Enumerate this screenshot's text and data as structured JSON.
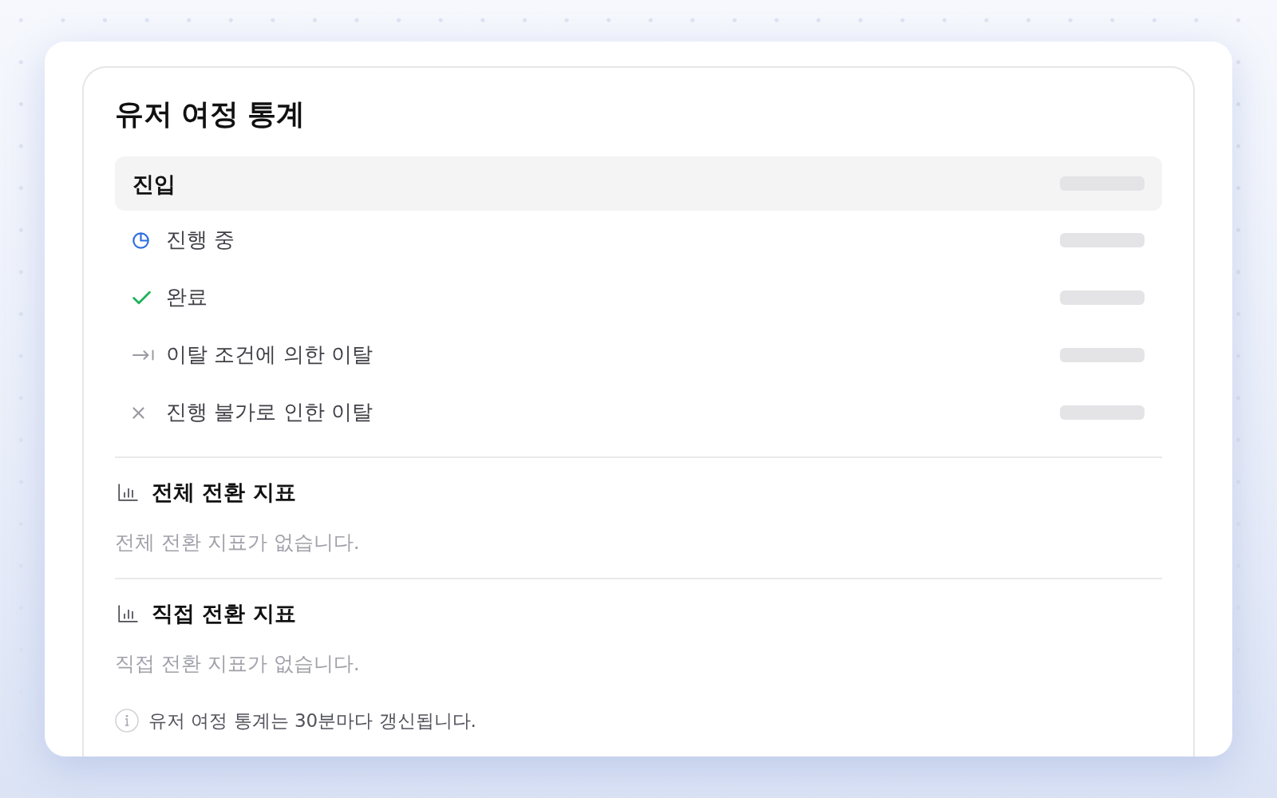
{
  "title": "유저 여정 통계",
  "stages": [
    {
      "kind": "total",
      "label": "진입",
      "loading": true
    },
    {
      "kind": "progress",
      "label": "진행 중",
      "loading": true
    },
    {
      "kind": "complete",
      "label": "완료",
      "loading": true
    },
    {
      "kind": "exit",
      "label": "이탈 조건에 의한 이탈",
      "loading": true
    },
    {
      "kind": "blocked",
      "label": "진행 불가로 인한 이탈",
      "loading": true
    }
  ],
  "metrics": [
    {
      "title": "전체 전환 지표",
      "empty_message": "전체 전환 지표가 없습니다."
    },
    {
      "title": "직접 전환 지표",
      "empty_message": "직접 전환 지표가 없습니다."
    }
  ],
  "footnote": "유저 여정 통계는 30분마다 갱신됩니다."
}
